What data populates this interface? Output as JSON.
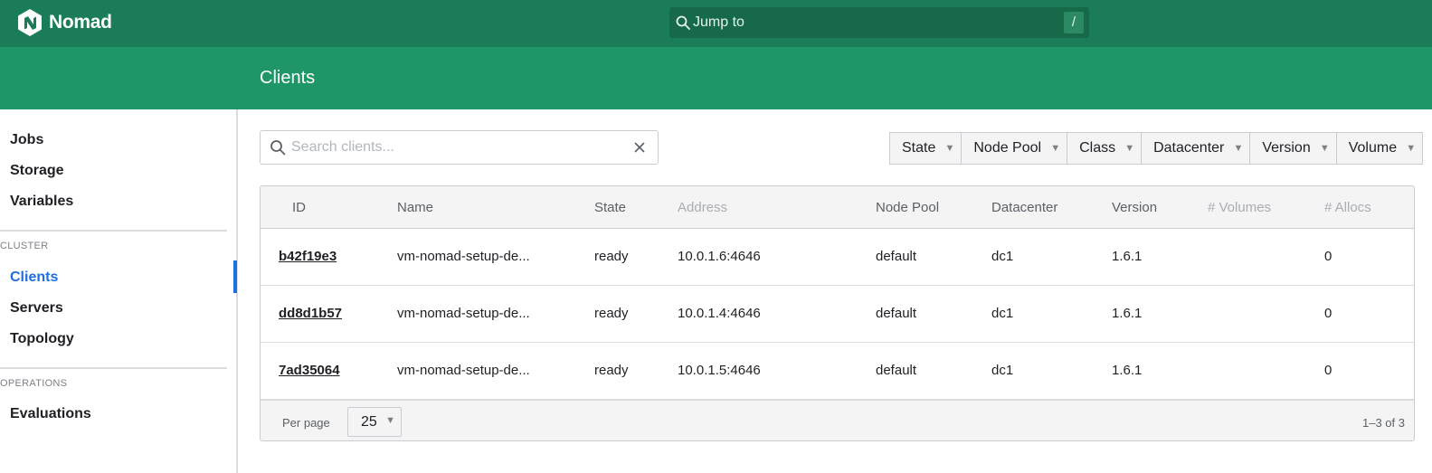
{
  "app": {
    "name": "Nomad"
  },
  "topbar": {
    "jump_label": "Jump to",
    "jump_key": "/"
  },
  "page": {
    "title": "Clients"
  },
  "sidebar": {
    "items_top": [
      {
        "label": "Jobs"
      },
      {
        "label": "Storage"
      },
      {
        "label": "Variables"
      }
    ],
    "cluster_heading": "CLUSTER",
    "cluster_items": [
      {
        "label": "Clients",
        "active": true
      },
      {
        "label": "Servers"
      },
      {
        "label": "Topology"
      }
    ],
    "operations_heading": "OPERATIONS",
    "operations_items": [
      {
        "label": "Evaluations"
      }
    ]
  },
  "search": {
    "placeholder": "Search clients...",
    "value": ""
  },
  "filters": [
    {
      "label": "State"
    },
    {
      "label": "Node Pool"
    },
    {
      "label": "Class"
    },
    {
      "label": "Datacenter"
    },
    {
      "label": "Version"
    },
    {
      "label": "Volume"
    }
  ],
  "table": {
    "columns": [
      "ID",
      "Name",
      "State",
      "Address",
      "Node Pool",
      "Datacenter",
      "Version",
      "# Volumes",
      "# Allocs"
    ],
    "rows": [
      {
        "id": "b42f19e3",
        "name": "vm-nomad-setup-de...",
        "state": "ready",
        "address": "10.0.1.6:4646",
        "node_pool": "default",
        "datacenter": "dc1",
        "version": "1.6.1",
        "volumes": "",
        "allocs": "0"
      },
      {
        "id": "dd8d1b57",
        "name": "vm-nomad-setup-de...",
        "state": "ready",
        "address": "10.0.1.4:4646",
        "node_pool": "default",
        "datacenter": "dc1",
        "version": "1.6.1",
        "volumes": "",
        "allocs": "0"
      },
      {
        "id": "7ad35064",
        "name": "vm-nomad-setup-de...",
        "state": "ready",
        "address": "10.0.1.5:4646",
        "node_pool": "default",
        "datacenter": "dc1",
        "version": "1.6.1",
        "volumes": "",
        "allocs": "0"
      }
    ]
  },
  "pagination": {
    "per_page_label": "Per page",
    "per_page_value": "25",
    "range": "1–3 of 3"
  },
  "colors": {
    "topbar": "#1b7d57",
    "subheader": "#1f9668",
    "active_link": "#1f6fe0"
  },
  "icons": {
    "logo": "nomad-logo-icon",
    "jump": "search-icon",
    "search": "search-icon",
    "clear": "close-icon",
    "caret": "caret-down-icon"
  }
}
